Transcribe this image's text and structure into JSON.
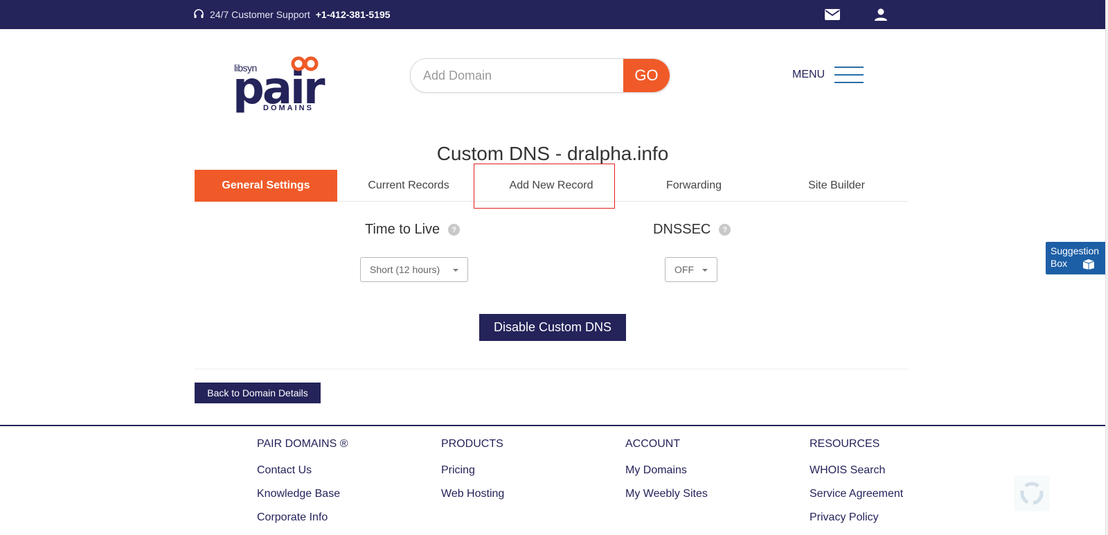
{
  "topbar": {
    "support_label": "24/7 Customer Support",
    "support_phone": "+1-412-381-5195",
    "icons": [
      "headset-icon",
      "mail-icon",
      "user-icon"
    ]
  },
  "logo": {
    "top_text": "libsyn",
    "main_text": "pair",
    "sub_text": "DOMAINS"
  },
  "search": {
    "placeholder": "Add Domain",
    "value": "",
    "button_label": "GO"
  },
  "menu": {
    "label": "MENU"
  },
  "page": {
    "title": "Custom DNS - dralpha.info"
  },
  "tabs": [
    {
      "label": "General Settings",
      "active": true
    },
    {
      "label": "Current Records",
      "active": false
    },
    {
      "label": "Add New Record",
      "active": false
    },
    {
      "label": "Forwarding",
      "active": false
    },
    {
      "label": "Site Builder",
      "active": false
    }
  ],
  "settings": {
    "ttl": {
      "label": "Time to Live",
      "help": "?",
      "selected": "Short (12 hours)"
    },
    "dnssec": {
      "label": "DNSSEC",
      "help": "?",
      "selected": "OFF"
    }
  },
  "buttons": {
    "disable_dns": "Disable Custom DNS",
    "back": "Back to Domain Details"
  },
  "footer": {
    "columns": [
      {
        "heading": "PAIR DOMAINS ®",
        "links": [
          "Contact Us",
          "Knowledge Base",
          "Corporate Info"
        ]
      },
      {
        "heading": "PRODUCTS",
        "links": [
          "Pricing",
          "Web Hosting"
        ]
      },
      {
        "heading": "ACCOUNT",
        "links": [
          "My Domains",
          "My Weebly Sites"
        ]
      },
      {
        "heading": "RESOURCES",
        "links": [
          "WHOIS Search",
          "Service Agreement",
          "Privacy Policy"
        ]
      }
    ]
  },
  "suggestion_box": {
    "line1": "Suggestion",
    "line2": "Box"
  },
  "colors": {
    "navy": "#24235a",
    "accent": "#f05a28",
    "link_blue": "#1d5fa6",
    "highlight": "#e0201b"
  }
}
